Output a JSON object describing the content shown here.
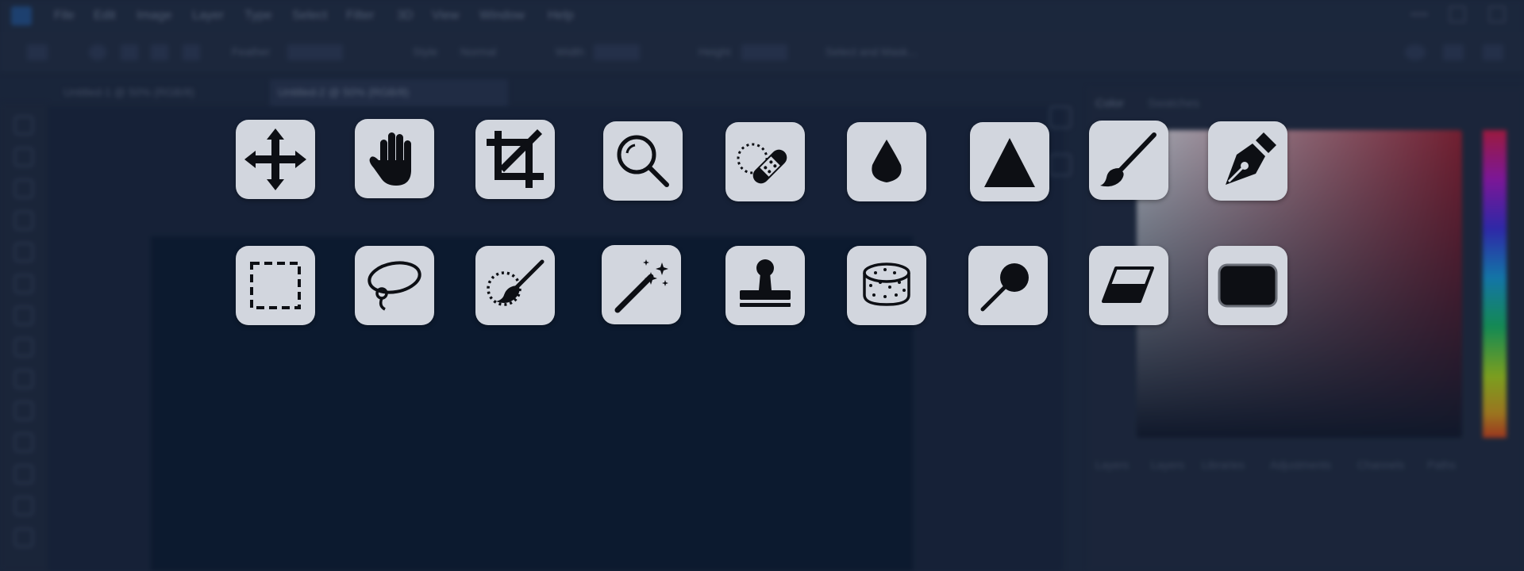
{
  "app": {
    "menu": [
      "File",
      "Edit",
      "Image",
      "Layer",
      "Type",
      "Select",
      "Filter",
      "3D",
      "View",
      "Window",
      "Help"
    ],
    "document_tabs": [
      "Untitled-1 @ 50% (RGB/8)",
      "Untitled-2 @ 50% (RGB/8)"
    ],
    "options_labels": [
      "Feather",
      "Style",
      "Normal",
      "Width",
      "Height",
      "Select and Mask..."
    ],
    "color_panel_tabs": [
      "Color",
      "Swatches"
    ],
    "lower_panel_tabs": [
      "Layers",
      "Layers",
      "Libraries",
      "Adjustments",
      "Channels",
      "Paths"
    ]
  },
  "tool_grid": {
    "row1": [
      {
        "icon": "move-icon"
      },
      {
        "icon": "hand-icon"
      },
      {
        "icon": "crop-icon"
      },
      {
        "icon": "zoom-icon"
      },
      {
        "icon": "healing-brush-icon"
      },
      {
        "icon": "blur-drop-icon"
      },
      {
        "icon": "sharpen-triangle-icon"
      },
      {
        "icon": "brush-icon"
      },
      {
        "icon": "pen-icon"
      }
    ],
    "row2": [
      {
        "icon": "marquee-icon"
      },
      {
        "icon": "lasso-icon"
      },
      {
        "icon": "quick-selection-icon"
      },
      {
        "icon": "magic-wand-icon"
      },
      {
        "icon": "clone-stamp-icon"
      },
      {
        "icon": "sponge-icon"
      },
      {
        "icon": "dodge-icon"
      },
      {
        "icon": "eraser-icon"
      },
      {
        "icon": "rectangle-shape-icon"
      }
    ]
  },
  "colors": {
    "card_bg": "#d2d6de",
    "icon_fill": "#0d0f14",
    "app_bg": "#1a2539",
    "canvas_bg": "#061428"
  }
}
